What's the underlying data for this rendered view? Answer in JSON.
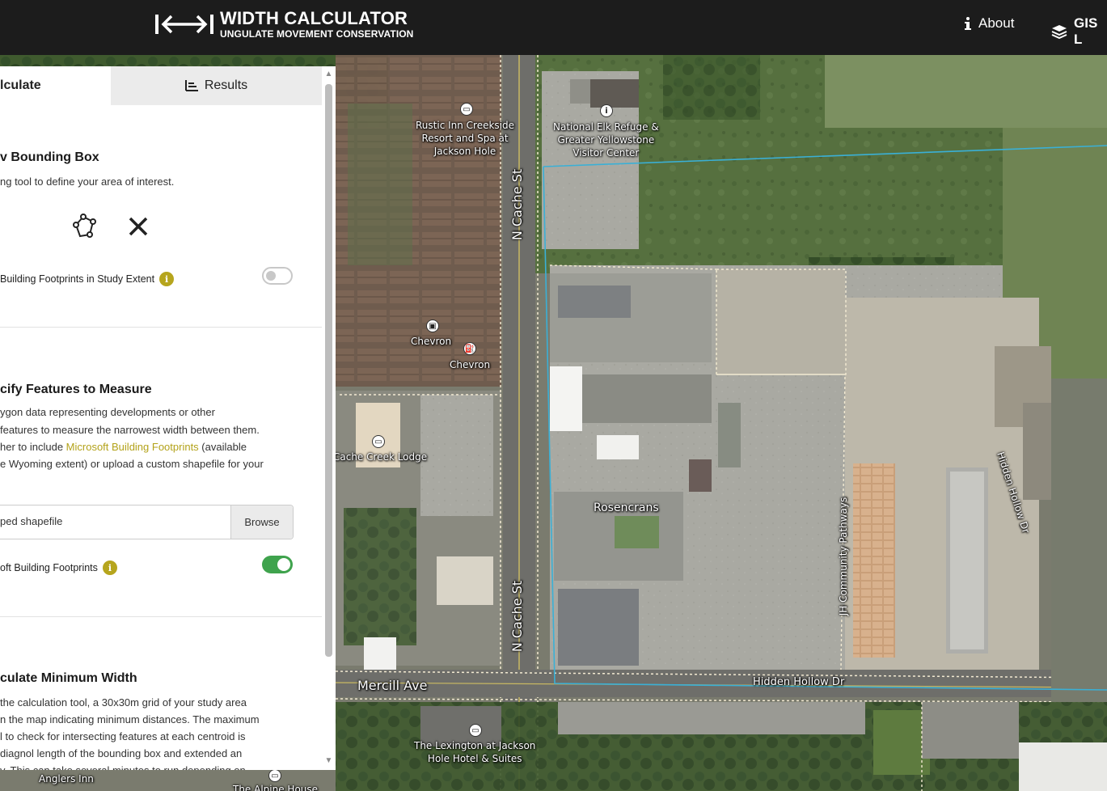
{
  "header": {
    "title": "WIDTH CALCULATOR",
    "subtitle": "UNGULATE MOVEMENT CONSERVATION",
    "nav_about": "About",
    "nav_gis": "GIS L"
  },
  "tabs": {
    "calculate": "lculate",
    "results": "Results"
  },
  "step1": {
    "heading": "v Bounding Box",
    "text": "ng tool to define your area of interest.",
    "toggle_label": "Building Footprints in Study Extent",
    "toggle_on": false
  },
  "step2": {
    "heading": "cify Features to Measure",
    "line1": "ygon data representing developments or other",
    "line2": "features to measure the narrowest width between them.",
    "line3_pre": "her to include ",
    "line3_link": "Microsoft Building Footprints",
    "line3_post": " (available",
    "line4": "e Wyoming extent) or upload a custom shapefile for your",
    "file_placeholder": "ped shapefile",
    "browse": "Browse",
    "toggle_label": "oft Building Footprints",
    "toggle_on": true
  },
  "step3": {
    "heading": "culate Minimum Width",
    "line1": " the calculation tool, a 30x30m grid of your study area",
    "line2": "n the map indicating minimum distances. The maximum",
    "line3": "l to check for intersecting features at each centroid is",
    "line4": "diagnol length of the bounding box and extended an",
    "line5": "y. This can take several minutes to run depending on"
  },
  "map": {
    "labels": {
      "rustic": "Rustic Inn Creekside\nResort and Spa at\nJackson Hole",
      "elk": "National Elk Refuge &\nGreater Yellowstone\nVisitor Center",
      "ncache1": "N Cache St",
      "ncache2": "N Cache St",
      "chevron1": "Chevron",
      "chevron2": "Chevron",
      "cachecreek": "Cache Creek Lodge",
      "rosencrans": "Rosencrans",
      "jhpath": "JH Community Pathways",
      "hiddenhollow1": "Hidden Hollow Dr",
      "hiddenhollow2": "Hidden Hollow Dr",
      "mercill": "Mercill Ave",
      "lexington": "The Lexington at Jackson\nHole Hotel & Suites",
      "anglers": "Anglers Inn",
      "alpine": "The Alpine House"
    },
    "colors": {
      "bbox": "#3ab0d6",
      "toggle_on": "#3fa34d",
      "accent": "#b6a51d"
    }
  }
}
